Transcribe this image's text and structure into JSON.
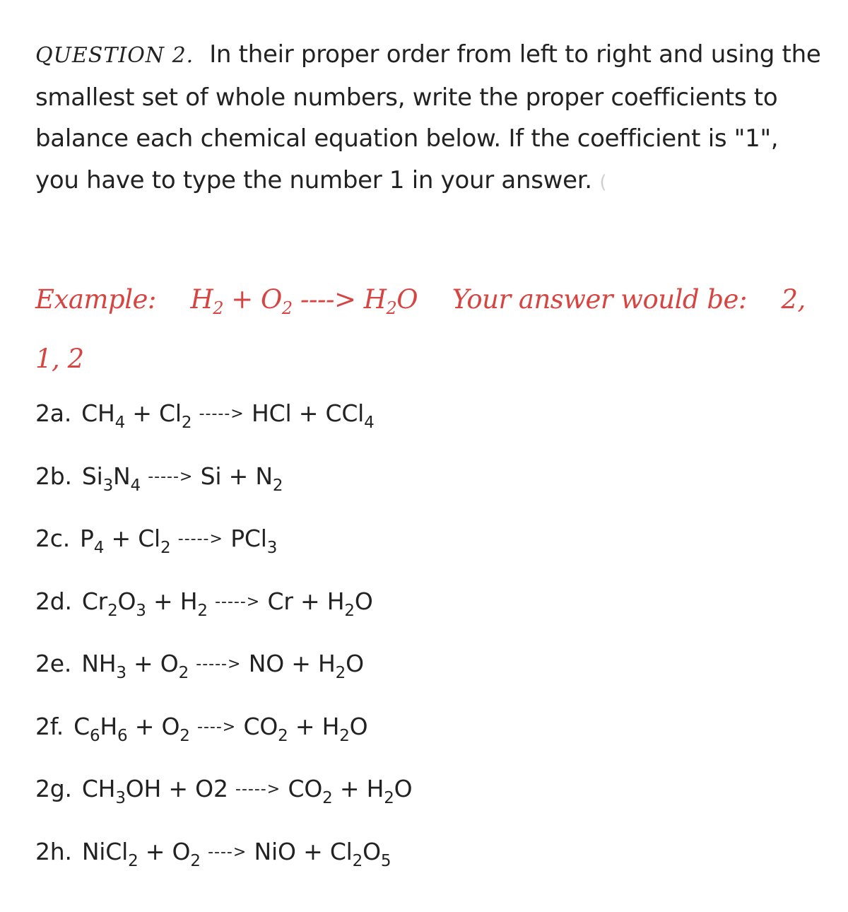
{
  "question": {
    "label": "QUESTION 2.",
    "text": "In their proper order from left to right and using the smallest set of whole numbers, write the proper coefficients to balance each chemical equation below.  If the coefficient is \"1\", you have to type the number 1 in your answer.",
    "trailing_mark": "("
  },
  "example": {
    "prefix": "Example:",
    "reactants": [
      {
        "symbol": "H",
        "sub": "2"
      },
      {
        "symbol": "O",
        "sub": "2"
      }
    ],
    "plus": "+",
    "arrow": "---->",
    "product": {
      "symbol": "H",
      "sub": "2",
      "rest": "O"
    },
    "answer_text": "Your answer would be:",
    "answer_value": "2, 1, 2",
    "color": "#d64541"
  },
  "equations": [
    {
      "label": "2a.",
      "left": [
        [
          {
            "t": "CH"
          },
          {
            "s": "4"
          }
        ],
        [
          {
            "t": "Cl"
          },
          {
            "s": "2"
          }
        ]
      ],
      "arrow": "----->",
      "right": [
        [
          {
            "t": "HCl"
          }
        ],
        [
          {
            "t": "CCl"
          },
          {
            "s": "4"
          }
        ]
      ]
    },
    {
      "label": "2b.",
      "left": [
        [
          {
            "t": "Si"
          },
          {
            "s": "3"
          },
          {
            "t": "N"
          },
          {
            "s": "4"
          }
        ]
      ],
      "arrow": "----->",
      "right": [
        [
          {
            "t": "Si"
          }
        ],
        [
          {
            "t": "N"
          },
          {
            "s": "2"
          }
        ]
      ]
    },
    {
      "label": "2c.",
      "left": [
        [
          {
            "t": "P"
          },
          {
            "s": "4"
          }
        ],
        [
          {
            "t": "Cl"
          },
          {
            "s": "2"
          }
        ]
      ],
      "arrow": "----->",
      "right": [
        [
          {
            "t": "PCl"
          },
          {
            "s": "3"
          }
        ]
      ]
    },
    {
      "label": "2d.",
      "left": [
        [
          {
            "t": "Cr"
          },
          {
            "s": "2"
          },
          {
            "t": "O"
          },
          {
            "s": "3"
          }
        ],
        [
          {
            "t": "H"
          },
          {
            "s": "2"
          }
        ]
      ],
      "arrow": "----->",
      "right": [
        [
          {
            "t": "Cr"
          }
        ],
        [
          {
            "t": "H"
          },
          {
            "s": "2"
          },
          {
            "t": "O"
          }
        ]
      ]
    },
    {
      "label": "2e.",
      "left": [
        [
          {
            "t": "NH"
          },
          {
            "s": "3"
          }
        ],
        [
          {
            "t": "O"
          },
          {
            "s": "2"
          }
        ]
      ],
      "arrow": "----->",
      "right": [
        [
          {
            "t": "NO"
          }
        ],
        [
          {
            "t": "H"
          },
          {
            "s": "2"
          },
          {
            "t": "O"
          }
        ]
      ]
    },
    {
      "label": "2f.",
      "left": [
        [
          {
            "t": "C"
          },
          {
            "s": "6"
          },
          {
            "t": "H"
          },
          {
            "s": "6"
          }
        ],
        [
          {
            "t": "O"
          },
          {
            "s": "2"
          }
        ]
      ],
      "arrow": "---->",
      "right": [
        [
          {
            "t": "CO"
          },
          {
            "s": "2"
          }
        ],
        [
          {
            "t": "H"
          },
          {
            "s": "2"
          },
          {
            "t": "O"
          }
        ]
      ]
    },
    {
      "label": "2g.",
      "left": [
        [
          {
            "t": "CH"
          },
          {
            "s": "3"
          },
          {
            "t": "OH"
          }
        ],
        [
          {
            "t": "O2"
          }
        ]
      ],
      "arrow": "----->",
      "right": [
        [
          {
            "t": "CO"
          },
          {
            "s": "2"
          }
        ],
        [
          {
            "t": "H"
          },
          {
            "s": "2"
          },
          {
            "t": "O"
          }
        ]
      ]
    },
    {
      "label": "2h.",
      "left": [
        [
          {
            "t": "NiCl"
          },
          {
            "s": "2"
          }
        ],
        [
          {
            "t": "O"
          },
          {
            "s": "2"
          }
        ]
      ],
      "arrow": "---->",
      "right": [
        [
          {
            "t": "NiO"
          }
        ],
        [
          {
            "t": "Cl"
          },
          {
            "s": "2"
          },
          {
            "t": "O"
          },
          {
            "s": "5"
          }
        ]
      ]
    }
  ]
}
